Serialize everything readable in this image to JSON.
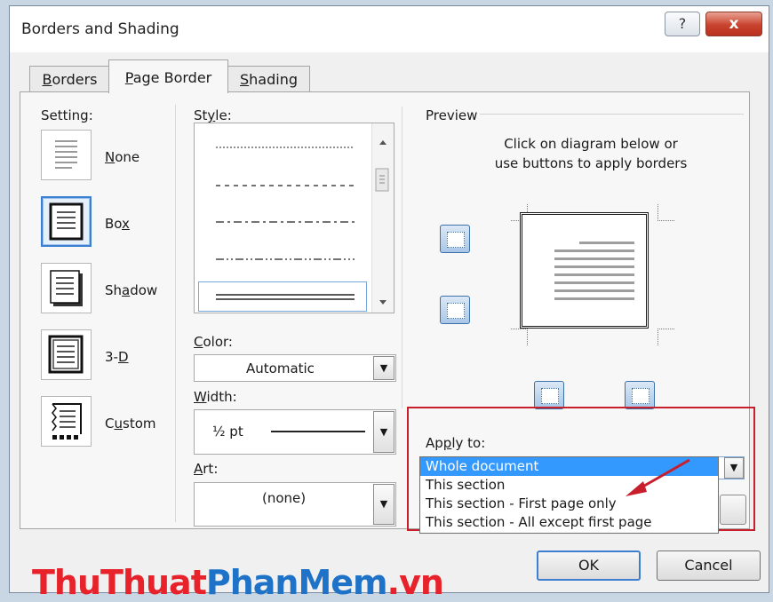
{
  "dialog": {
    "title": "Borders and Shading",
    "help_label": "?",
    "close_label": "x"
  },
  "tabs": [
    {
      "label": "Borders",
      "underline": "B",
      "rest": "orders"
    },
    {
      "label": "Page Border",
      "underline": "P",
      "rest": "age Border"
    },
    {
      "label": "Shading",
      "underline": "S",
      "rest": "hading"
    }
  ],
  "setting": {
    "label": "Setting:",
    "items": [
      {
        "label": "None",
        "pre": "",
        "underline": "N",
        "rest": "one"
      },
      {
        "label": "Box",
        "pre": "Bo",
        "underline": "x",
        "rest": ""
      },
      {
        "label": "Shadow",
        "pre": "Sh",
        "underline": "a",
        "rest": "dow"
      },
      {
        "label": "3-D",
        "pre": "3-",
        "underline": "D",
        "rest": ""
      },
      {
        "label": "Custom",
        "pre": "C",
        "underline": "u",
        "rest": "stom"
      }
    ],
    "selected": "Box"
  },
  "style": {
    "label": "Style:",
    "pre": "St",
    "underline": "y",
    "rest": "le:"
  },
  "color": {
    "label": "Color:",
    "pre": "",
    "underline": "C",
    "rest": "olor:",
    "value": "Automatic"
  },
  "width": {
    "label": "Width:",
    "pre": "",
    "underline": "W",
    "rest": "idth:",
    "value": "½ pt"
  },
  "art": {
    "label": "Art:",
    "pre": "",
    "underline": "A",
    "rest": "rt:",
    "value": "(none)"
  },
  "preview": {
    "label": "Preview",
    "instruction_line1": "Click on diagram below or",
    "instruction_line2": "use buttons to apply borders"
  },
  "apply_to": {
    "label": "Apply to:",
    "pre": "Ap",
    "underline": "p",
    "rest": "ly to:",
    "selected": "Whole document",
    "options": [
      "Whole document",
      "This section",
      "This section - First page only",
      "This section - All except first page"
    ]
  },
  "buttons": {
    "ok": "OK",
    "cancel": "Cancel"
  },
  "watermark": {
    "part1": "ThuThuat",
    "part2": "PhanMem",
    "part3": ".vn"
  },
  "colors": {
    "accent": "#3399ff",
    "highlight_box": "#c71f2c",
    "watermark_red": "#e8222b",
    "watermark_blue": "#1e73c8"
  }
}
